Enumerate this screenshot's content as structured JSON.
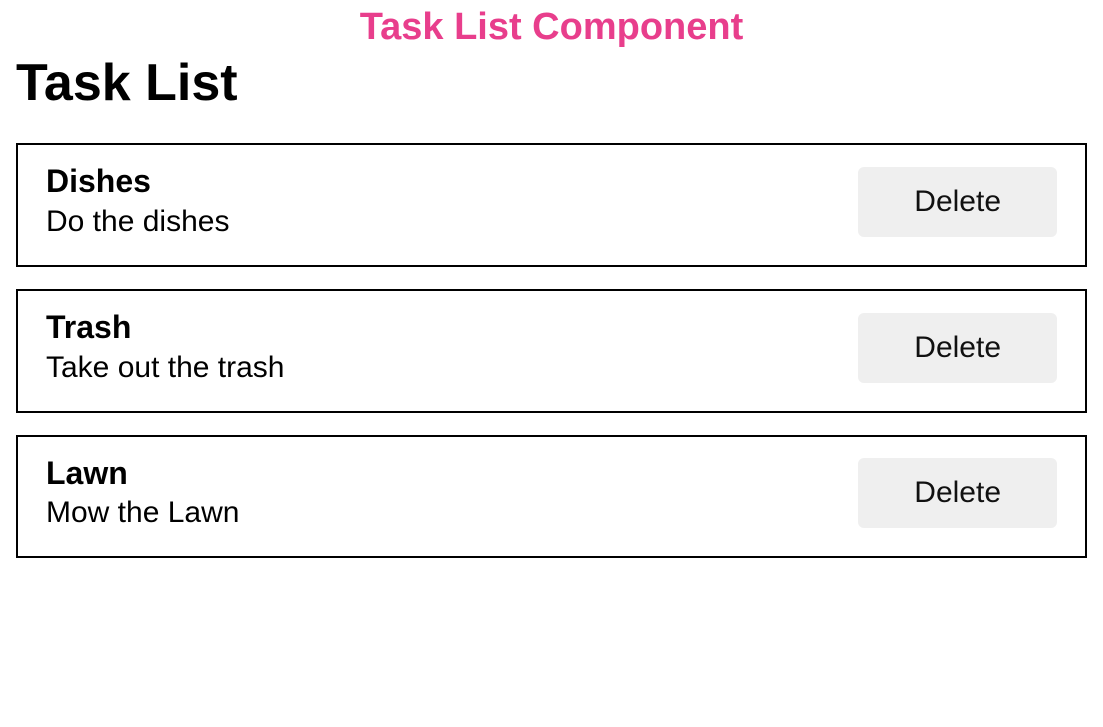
{
  "header": {
    "page_title": "Task List Component",
    "section_title": "Task List"
  },
  "delete_label": "Delete",
  "tasks": [
    {
      "title": "Dishes",
      "description": "Do the dishes"
    },
    {
      "title": "Trash",
      "description": "Take out the trash"
    },
    {
      "title": "Lawn",
      "description": "Mow the Lawn"
    }
  ]
}
